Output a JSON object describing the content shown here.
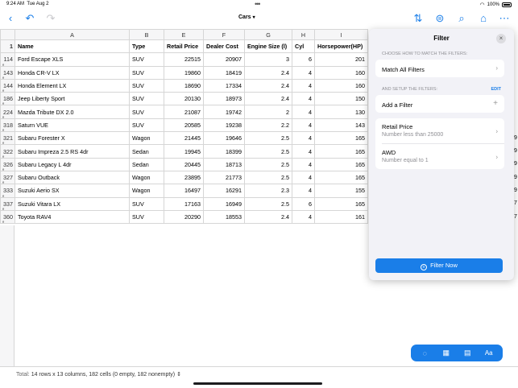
{
  "status": {
    "time": "9:24 AM",
    "date": "Tue Aug 2",
    "battery": "100%"
  },
  "toolbar": {
    "title": "Cars"
  },
  "columns": [
    "A",
    "B",
    "E",
    "F",
    "G",
    "H",
    "I"
  ],
  "header_row": {
    "num": "1",
    "cells": [
      "Name",
      "Type",
      "Retail Price",
      "Dealer Cost",
      "Engine Size (l)",
      "Cyl",
      "Horsepower(HP)"
    ]
  },
  "rows": [
    {
      "num": "114",
      "cells": [
        "Ford Escape XLS",
        "SUV",
        "22515",
        "20907",
        "3",
        "6",
        "201"
      ]
    },
    {
      "num": "143",
      "cells": [
        "Honda CR-V LX",
        "SUV",
        "19860",
        "18419",
        "2.4",
        "4",
        "160"
      ]
    },
    {
      "num": "144",
      "cells": [
        "Honda Element LX",
        "SUV",
        "18690",
        "17334",
        "2.4",
        "4",
        "160"
      ]
    },
    {
      "num": "186",
      "cells": [
        "Jeep Liberty Sport",
        "SUV",
        "20130",
        "18973",
        "2.4",
        "4",
        "150"
      ]
    },
    {
      "num": "224",
      "cells": [
        "Mazda Tribute DX 2.0",
        "SUV",
        "21087",
        "19742",
        "2",
        "4",
        "130"
      ]
    },
    {
      "num": "318",
      "cells": [
        "Saturn VUE",
        "SUV",
        "20585",
        "19238",
        "2.2",
        "4",
        "143"
      ]
    },
    {
      "num": "321",
      "cells": [
        "Subaru Forester X",
        "Wagon",
        "21445",
        "19646",
        "2.5",
        "4",
        "165"
      ]
    },
    {
      "num": "322",
      "cells": [
        "Subaru Impreza 2.5 RS 4dr",
        "Sedan",
        "19945",
        "18399",
        "2.5",
        "4",
        "165"
      ]
    },
    {
      "num": "326",
      "cells": [
        "Subaru Legacy L 4dr",
        "Sedan",
        "20445",
        "18713",
        "2.5",
        "4",
        "165"
      ]
    },
    {
      "num": "327",
      "cells": [
        "Subaru Outback",
        "Wagon",
        "23895",
        "21773",
        "2.5",
        "4",
        "165"
      ]
    },
    {
      "num": "333",
      "cells": [
        "Suzuki Aerio SX",
        "Wagon",
        "16497",
        "16291",
        "2.3",
        "4",
        "155"
      ]
    },
    {
      "num": "337",
      "cells": [
        "Suzuki Vitara LX",
        "SUV",
        "17163",
        "16949",
        "2.5",
        "6",
        "165"
      ]
    },
    {
      "num": "360",
      "cells": [
        "Toyota RAV4",
        "SUV",
        "20290",
        "18553",
        "2.4",
        "4",
        "161"
      ]
    }
  ],
  "right_edge": [
    "",
    "",
    "",
    "",
    "",
    "",
    "9",
    "9",
    "9",
    "9",
    "9",
    "7",
    "7"
  ],
  "panel": {
    "title": "Filter",
    "match_section": "CHOOSE HOW TO MATCH THE FILTERS:",
    "match_label": "Match All Filters",
    "setup_section": "AND SETUP THE FILTERS:",
    "edit_label": "EDIT",
    "add_filter": "Add a Filter",
    "filters": [
      {
        "label": "Retail Price",
        "condition": "Number less than 25000"
      },
      {
        "label": "AWD",
        "condition": "Number equal to 1"
      }
    ],
    "filter_now": "Filter Now"
  },
  "fab": {
    "font_label": "Aa"
  },
  "footer": {
    "total_key": "Total:",
    "total_value": "14 rows x 13 columns, 182 cells (0 empty, 182 nonempty)"
  }
}
